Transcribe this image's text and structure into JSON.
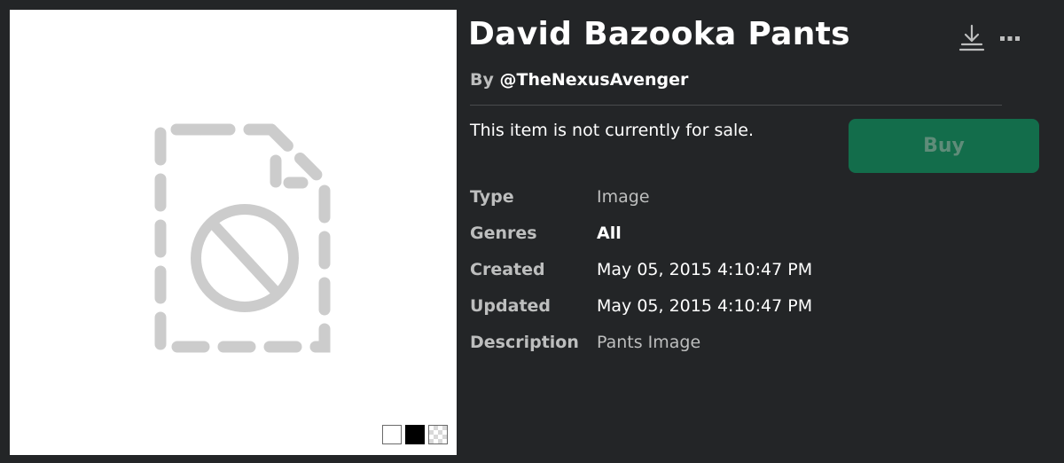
{
  "item": {
    "title": "David Bazooka Pants",
    "by_prefix": "By ",
    "creator": "@TheNexusAvenger"
  },
  "header_actions": {
    "download_icon": "download-icon",
    "more_icon": "more-options-icon"
  },
  "purchase": {
    "status_text": "This item is not currently for sale.",
    "buy_label": "Buy",
    "buy_color": "#136d4b"
  },
  "details": [
    {
      "label": "Type",
      "value": "Image"
    },
    {
      "label": "Genres",
      "value": "All"
    },
    {
      "label": "Created",
      "value": "May 05, 2015 4:10:47 PM"
    },
    {
      "label": "Updated",
      "value": "May 05, 2015 4:10:47 PM"
    },
    {
      "label": "Description",
      "value": "Pants Image"
    }
  ],
  "thumbnail": {
    "placeholder_icon": "unavailable-file-icon",
    "background_options": [
      "white",
      "black",
      "transparent"
    ]
  },
  "colors": {
    "page_background": "#232527",
    "label_gray": "#bdbebe"
  }
}
